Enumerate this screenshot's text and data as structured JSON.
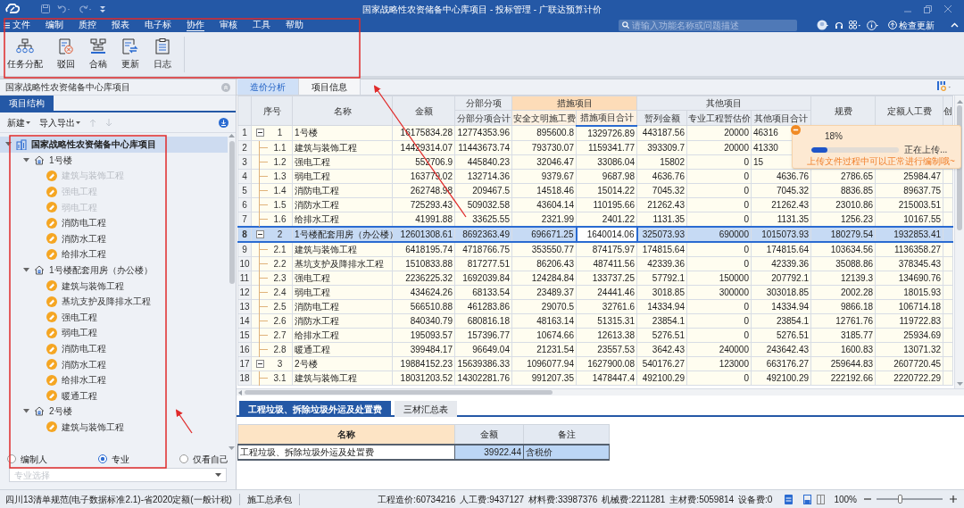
{
  "window": {
    "title": "国家战略性农资储备中心库项目 - 投标管理 - 广联达预算计价"
  },
  "menu": [
    {
      "label": "文件",
      "selected": false
    },
    {
      "label": "编制",
      "selected": false
    },
    {
      "label": "质控",
      "selected": false
    },
    {
      "label": "报表",
      "selected": false
    },
    {
      "label": "电子标",
      "selected": false
    },
    {
      "label": "协作",
      "selected": true
    },
    {
      "label": "审核",
      "selected": false
    },
    {
      "label": "工具",
      "selected": false
    },
    {
      "label": "帮助",
      "selected": false
    }
  ],
  "search": {
    "placeholder": "请输入功能名称或问题描述"
  },
  "update_button": "检查更新",
  "ribbon": [
    {
      "label": "任务分配",
      "kind": "assign"
    },
    {
      "label": "驳回",
      "kind": "reject"
    },
    {
      "label": "合稿",
      "kind": "merge"
    },
    {
      "label": "更新",
      "kind": "update"
    },
    {
      "label": "日志",
      "kind": "log"
    }
  ],
  "left_panel": {
    "title": "国家战略性农资储备中心库项目",
    "tab": {
      "label": "项目结构",
      "selected": true
    },
    "toolbar": [
      "新建",
      "导入导出"
    ],
    "tree": [
      {
        "label": "国家战略性农资储备中心库项目",
        "expanded": true,
        "selected": true,
        "children": [
          {
            "label": "1号楼",
            "expanded": true,
            "selected": false,
            "children": [
              {
                "label": "建筑与装饰工程",
                "disabled": true,
                "selected": false
              },
              {
                "label": "强电工程",
                "disabled": true,
                "selected": false
              },
              {
                "label": "弱电工程",
                "disabled": true,
                "selected": false
              },
              {
                "label": "消防电工程",
                "disabled": false,
                "selected": false
              },
              {
                "label": "消防水工程",
                "disabled": false,
                "selected": false
              },
              {
                "label": "给排水工程",
                "disabled": false,
                "selected": false
              }
            ]
          },
          {
            "label": "1号楼配套用房（办公楼）",
            "expanded": true,
            "selected": false,
            "children": [
              {
                "label": "建筑与装饰工程",
                "disabled": false,
                "selected": false
              },
              {
                "label": "基坑支护及降排水工程",
                "disabled": false,
                "selected": false
              },
              {
                "label": "强电工程",
                "disabled": false,
                "selected": false
              },
              {
                "label": "弱电工程",
                "disabled": false,
                "selected": false
              },
              {
                "label": "消防电工程",
                "disabled": false,
                "selected": false
              },
              {
                "label": "消防水工程",
                "disabled": false,
                "selected": false
              },
              {
                "label": "给排水工程",
                "disabled": false,
                "selected": false
              },
              {
                "label": "暖通工程",
                "disabled": false,
                "selected": false
              }
            ]
          },
          {
            "label": "2号楼",
            "expanded": true,
            "selected": false,
            "children": [
              {
                "label": "建筑与装饰工程",
                "disabled": false,
                "selected": false
              }
            ]
          }
        ]
      }
    ],
    "filters": [
      {
        "label": "编制人",
        "selected": false
      },
      {
        "label": "专业",
        "selected": true
      },
      {
        "label": "仅看自己",
        "selected": false
      }
    ],
    "specialty_select": {
      "placeholder": "专业选择"
    }
  },
  "tabs": [
    {
      "label": "造价分析",
      "selected": true
    },
    {
      "label": "项目信息",
      "selected": false
    }
  ],
  "table": {
    "columns": [
      {
        "label": "序号"
      },
      {
        "label": "名称"
      },
      {
        "label": "金额"
      },
      {
        "group": "分部分项",
        "highlighted": false,
        "columns": [
          {
            "label": "分部分项合计",
            "selected": false
          }
        ]
      },
      {
        "group": "措施项目",
        "highlighted": true,
        "columns": [
          {
            "label": "安全文明施工费",
            "selected": false
          },
          {
            "label": "措施项目合计",
            "selected": true
          }
        ]
      },
      {
        "group": "其他项目",
        "highlighted": false,
        "columns": [
          {
            "label": "暂列金额",
            "selected": false
          },
          {
            "label": "专业工程暂估价",
            "selected": false
          },
          {
            "label": "其他项目合计",
            "selected": false
          }
        ]
      },
      {
        "label": "规费"
      },
      {
        "label": "定额人工费"
      },
      {
        "label": "创"
      }
    ],
    "rows": [
      {
        "num": "1",
        "seq": "1",
        "kind": "group",
        "expanded": true,
        "selected": false,
        "name": "1号楼",
        "values": [
          "16175834.28",
          "12774353.96",
          "895600.8",
          "1329726.89",
          "443187.56",
          "20000",
          "46316"
        ]
      },
      {
        "num": "2",
        "seq": "1.1",
        "kind": "item",
        "selected": false,
        "name": "建筑与装饰工程",
        "values": [
          "14429314.07",
          "11443673.74",
          "793730.07",
          "1159341.77",
          "393309.7",
          "20000",
          "41330"
        ]
      },
      {
        "num": "3",
        "seq": "1.2",
        "kind": "item",
        "selected": false,
        "name": "强电工程",
        "values": [
          "552706.9",
          "445840.23",
          "32046.47",
          "33086.04",
          "15802",
          "0",
          "15"
        ]
      },
      {
        "num": "4",
        "seq": "1.3",
        "kind": "item",
        "selected": false,
        "name": "弱电工程",
        "values": [
          "163779.02",
          "132714.36",
          "9379.67",
          "9687.98",
          "4636.76",
          "0",
          "4636.76",
          "2786.65",
          "25984.47"
        ]
      },
      {
        "num": "5",
        "seq": "1.4",
        "kind": "item",
        "selected": false,
        "name": "消防电工程",
        "values": [
          "262748.98",
          "209467.5",
          "14518.46",
          "15014.22",
          "7045.32",
          "0",
          "7045.32",
          "8836.85",
          "89637.75"
        ]
      },
      {
        "num": "6",
        "seq": "1.5",
        "kind": "item",
        "selected": false,
        "name": "消防水工程",
        "values": [
          "725293.43",
          "509032.58",
          "43604.14",
          "110195.66",
          "21262.43",
          "0",
          "21262.43",
          "23010.86",
          "215003.51"
        ]
      },
      {
        "num": "7",
        "seq": "1.6",
        "kind": "item",
        "selected": false,
        "name": "给排水工程",
        "values": [
          "41991.88",
          "33625.55",
          "2321.99",
          "2401.22",
          "1131.35",
          "0",
          "1131.35",
          "1256.23",
          "10167.55"
        ]
      },
      {
        "num": "8",
        "seq": "2",
        "kind": "group",
        "expanded": true,
        "selected": true,
        "name": "1号楼配套用房（办公楼）",
        "values": [
          "12601308.61",
          "8692363.49",
          "696671.25",
          "1640014.06",
          "325073.93",
          "690000",
          "1015073.93",
          "180279.54",
          "1932853.41"
        ]
      },
      {
        "num": "9",
        "seq": "2.1",
        "kind": "item",
        "selected": false,
        "name": "建筑与装饰工程",
        "values": [
          "6418195.74",
          "4718766.75",
          "353550.77",
          "874175.97",
          "174815.64",
          "0",
          "174815.64",
          "103634.56",
          "1136358.27"
        ]
      },
      {
        "num": "10",
        "seq": "2.2",
        "kind": "item",
        "selected": false,
        "name": "基坑支护及降排水工程",
        "values": [
          "1510833.88",
          "817277.51",
          "86206.43",
          "487411.56",
          "42339.36",
          "0",
          "42339.36",
          "35088.86",
          "378345.43"
        ]
      },
      {
        "num": "11",
        "seq": "2.3",
        "kind": "item",
        "selected": false,
        "name": "强电工程",
        "values": [
          "2236225.32",
          "1692039.84",
          "124284.84",
          "133737.25",
          "57792.1",
          "150000",
          "207792.1",
          "12139.3",
          "134690.76"
        ]
      },
      {
        "num": "12",
        "seq": "2.4",
        "kind": "item",
        "selected": false,
        "name": "弱电工程",
        "values": [
          "434624.26",
          "68133.54",
          "23489.37",
          "24441.46",
          "3018.85",
          "300000",
          "303018.85",
          "2002.28",
          "18015.93"
        ]
      },
      {
        "num": "13",
        "seq": "2.5",
        "kind": "item",
        "selected": false,
        "name": "消防电工程",
        "values": [
          "566510.88",
          "461283.86",
          "29070.5",
          "32761.6",
          "14334.94",
          "0",
          "14334.94",
          "9866.18",
          "106714.18"
        ]
      },
      {
        "num": "14",
        "seq": "2.6",
        "kind": "item",
        "selected": false,
        "name": "消防水工程",
        "values": [
          "840340.79",
          "680816.18",
          "48163.14",
          "51315.31",
          "23854.1",
          "0",
          "23854.1",
          "12761.76",
          "119722.83"
        ]
      },
      {
        "num": "15",
        "seq": "2.7",
        "kind": "item",
        "selected": false,
        "name": "给排水工程",
        "values": [
          "195093.57",
          "157396.77",
          "10674.66",
          "12613.38",
          "5276.51",
          "0",
          "5276.51",
          "3185.77",
          "25934.69"
        ]
      },
      {
        "num": "16",
        "seq": "2.8",
        "kind": "item",
        "selected": false,
        "name": "暖通工程",
        "values": [
          "399484.17",
          "96649.04",
          "21231.54",
          "23557.53",
          "3642.43",
          "240000",
          "243642.43",
          "1600.83",
          "13071.32"
        ]
      },
      {
        "num": "17",
        "seq": "3",
        "kind": "group",
        "expanded": true,
        "selected": false,
        "name": "2号楼",
        "values": [
          "19884152.23",
          "15639386.33",
          "1096077.94",
          "1627900.08",
          "540176.27",
          "123000",
          "663176.27",
          "259644.83",
          "2607720.45"
        ]
      },
      {
        "num": "18",
        "seq": "3.1",
        "kind": "item",
        "selected": false,
        "name": "建筑与装饰工程",
        "values": [
          "18031203.52",
          "14302281.76",
          "991207.35",
          "1478447.4",
          "492100.29",
          "0",
          "492100.29",
          "222192.66",
          "2220722.29"
        ]
      }
    ]
  },
  "upload": {
    "percent": "18%",
    "level": 0.18,
    "status": "正在上传...",
    "note": "上传文件过程中可以正常进行编制哦~"
  },
  "bottom_tabs": [
    {
      "label": "工程垃圾、拆除垃圾外运及处置费",
      "selected": true
    },
    {
      "label": "三材汇总表",
      "selected": false
    }
  ],
  "bottom_table": {
    "columns": [
      "名称",
      "金额",
      "备注"
    ],
    "rows": [
      [
        "工程垃圾、拆除垃圾外运及处置费",
        "39922.44",
        "含税价"
      ]
    ]
  },
  "status_bar": {
    "standard": "四川13清单规范(电子数据标准2.1)-省2020定额(一般计税)",
    "contract": "施工总承包",
    "totals": [
      "工程造价:60734216",
      "人工费:9437127",
      "材料费:33987376",
      "机械费:2211281",
      "主材费:5059814",
      "设备费:0"
    ],
    "zoom": "100%",
    "zoom_level": {
      "level": 0.35
    }
  }
}
